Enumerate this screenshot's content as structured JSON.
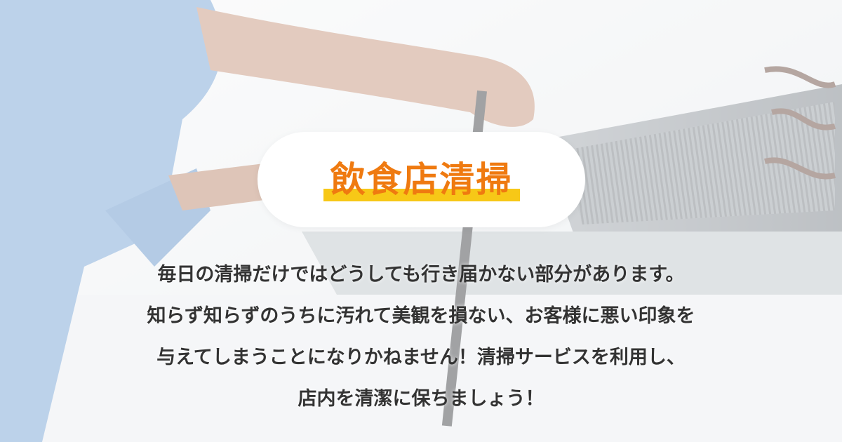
{
  "banner": {
    "title": "飲食店清掃",
    "description_lines": [
      "毎日の清掃だけではどうしても行き届かない部分があります。",
      "知らず知らずのうちに汚れて美観を損ない、お客様に悪い印象を",
      "与えてしまうことになりかねません！清掃サービスを利用し、",
      "店内を清潔に保ちましょう！"
    ],
    "colors": {
      "title_text": "#ef7a10",
      "title_highlight": "#f7c817",
      "body_text": "#333333",
      "pill_background": "#ffffff"
    }
  }
}
